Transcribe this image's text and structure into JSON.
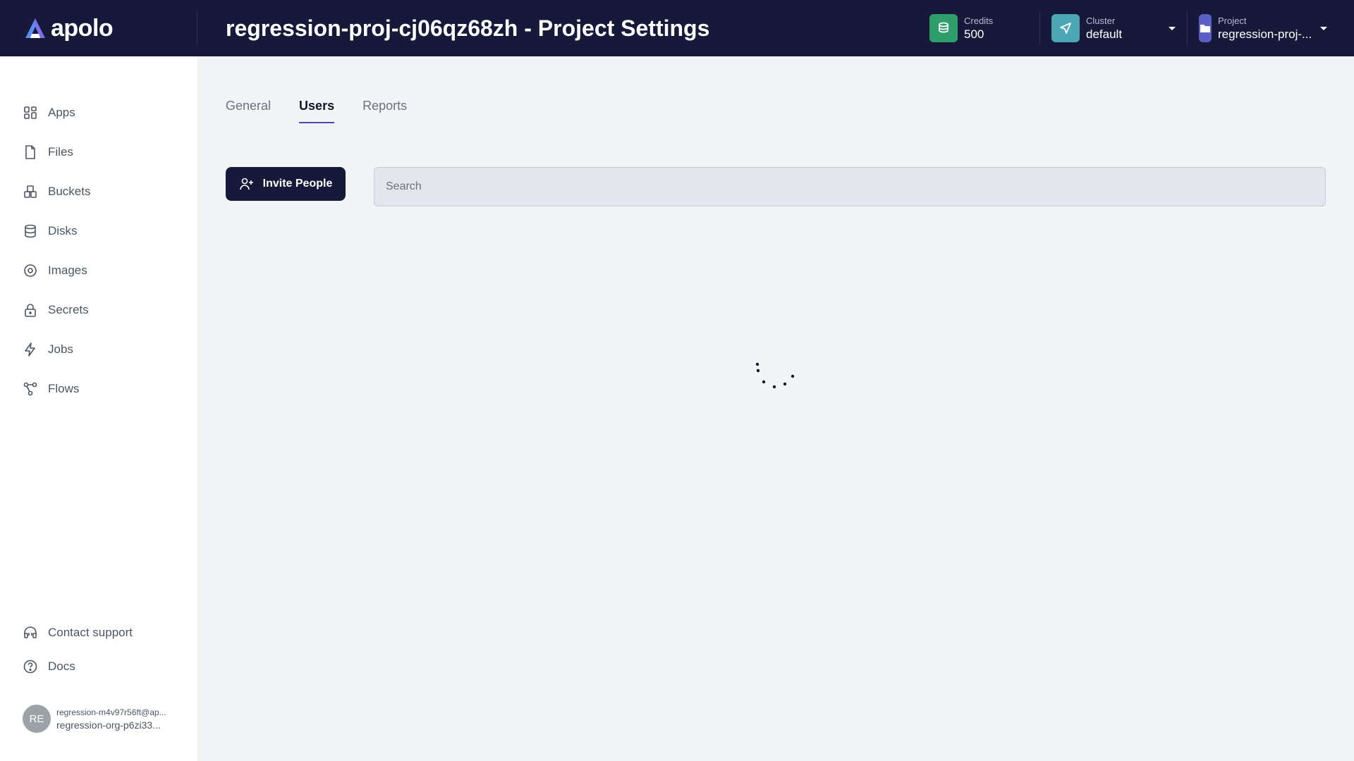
{
  "app": {
    "name": "apolo"
  },
  "header": {
    "title": "regression-proj-cj06qz68zh - Project Settings",
    "credits": {
      "label": "Credits",
      "value": "500",
      "color": "#2f9e6b"
    },
    "cluster": {
      "label": "Cluster",
      "value": "default",
      "color": "#4aa7b3"
    },
    "project": {
      "label": "Project",
      "value": "regression-proj-...",
      "color": "#5b5fc7"
    }
  },
  "sidebar": {
    "items": [
      {
        "label": "Apps",
        "icon": "apps-icon"
      },
      {
        "label": "Files",
        "icon": "file-icon"
      },
      {
        "label": "Buckets",
        "icon": "buckets-icon"
      },
      {
        "label": "Disks",
        "icon": "database-icon"
      },
      {
        "label": "Images",
        "icon": "image-icon"
      },
      {
        "label": "Secrets",
        "icon": "lock-icon"
      },
      {
        "label": "Jobs",
        "icon": "lightning-icon"
      },
      {
        "label": "Flows",
        "icon": "flow-icon"
      }
    ],
    "bottom": [
      {
        "label": "Contact support",
        "icon": "headset-icon"
      },
      {
        "label": "Docs",
        "icon": "help-circle-icon"
      }
    ],
    "user": {
      "initials": "RE",
      "email": "regression-m4v97r56ft@ap...",
      "org": "regression-org-p6zi33..."
    }
  },
  "tabs": [
    {
      "label": "General",
      "active": false
    },
    {
      "label": "Users",
      "active": true
    },
    {
      "label": "Reports",
      "active": false
    }
  ],
  "actions": {
    "invite_label": "Invite People"
  },
  "search": {
    "placeholder": "Search",
    "value": ""
  },
  "colors": {
    "header_bg": "#16193a",
    "accent": "#4f46a8"
  }
}
